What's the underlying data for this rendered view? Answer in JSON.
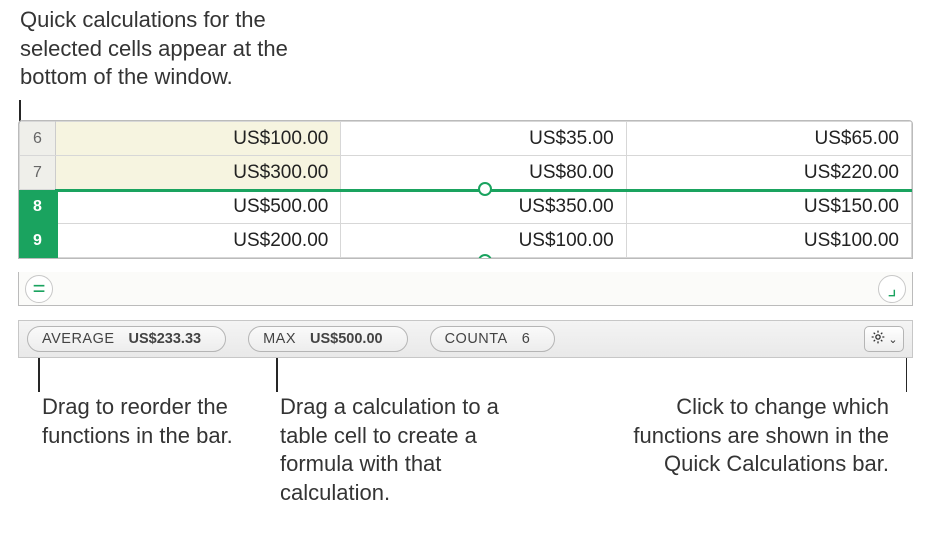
{
  "callouts": {
    "top": "Quick calculations for the selected cells appear at the bottom of the window.",
    "bottomLeft": "Drag to reorder the functions in the bar.",
    "bottomMid": "Drag a calculation to a table cell to create a formula with that calculation.",
    "bottomRight": "Click to change which functions are shown in the Quick Calculations bar."
  },
  "rows": [
    {
      "n": "6",
      "a": "US$100.00",
      "b": "US$35.00",
      "c": "US$65.00",
      "selected": false
    },
    {
      "n": "7",
      "a": "US$300.00",
      "b": "US$80.00",
      "c": "US$220.00",
      "selected": false
    },
    {
      "n": "8",
      "a": "US$500.00",
      "b": "US$350.00",
      "c": "US$150.00",
      "selected": true
    },
    {
      "n": "9",
      "a": "US$200.00",
      "b": "US$100.00",
      "c": "US$100.00",
      "selected": true
    }
  ],
  "footer": {
    "eqGlyph": "=",
    "cornerGlyph": "⌟"
  },
  "qc": {
    "items": [
      {
        "fn": "AVERAGE",
        "val": "US$233.33",
        "bold": true
      },
      {
        "fn": "MAX",
        "val": "US$500.00",
        "bold": true
      },
      {
        "fn": "COUNTA",
        "val": "6",
        "bold": false
      }
    ],
    "gearIcon": "gear-icon",
    "chevGlyph": "⌄"
  }
}
